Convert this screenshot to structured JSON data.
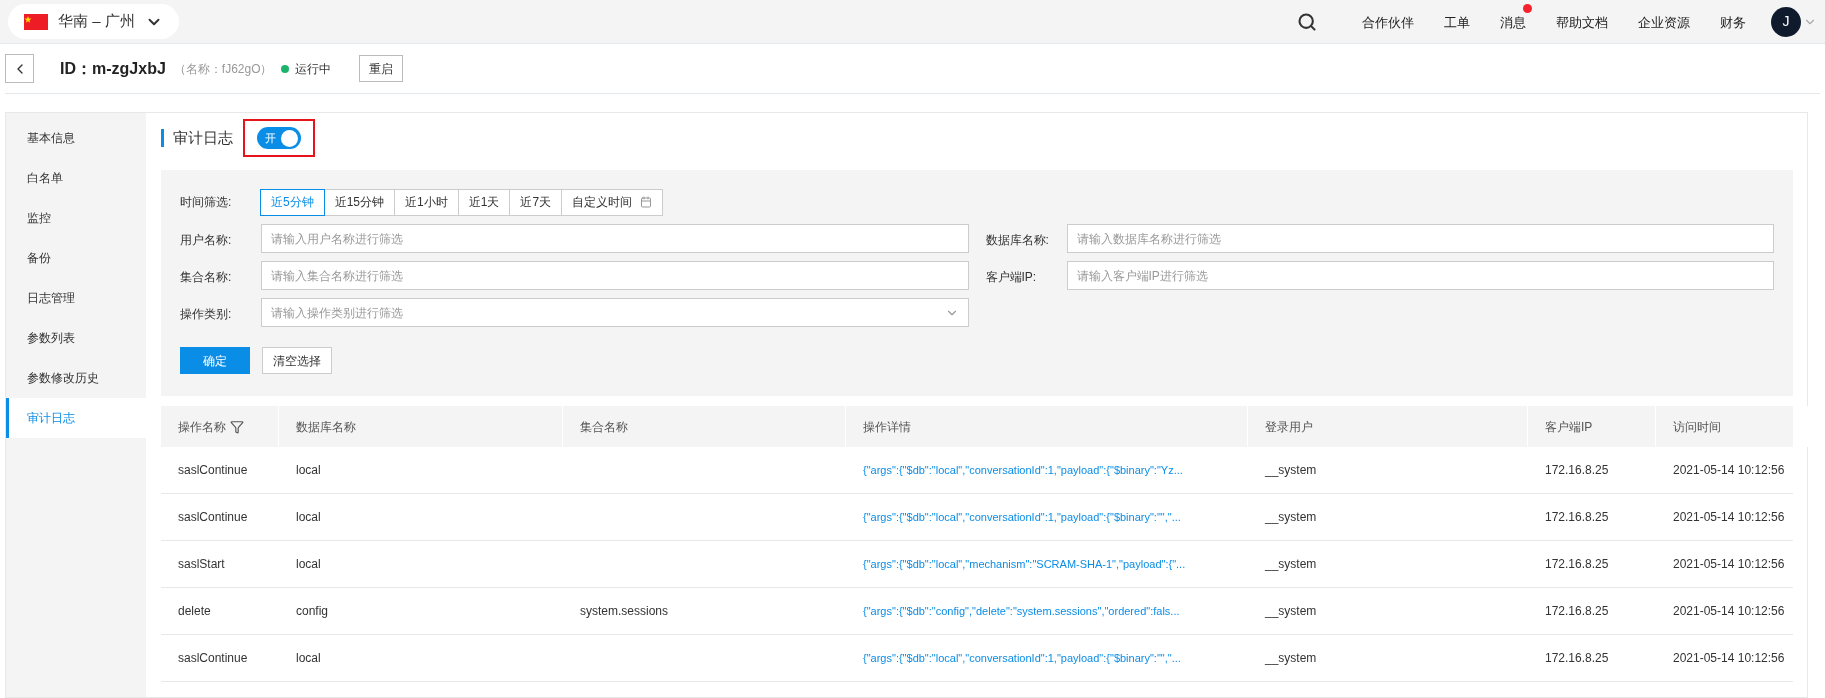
{
  "topbar": {
    "region": "华南 – 广州",
    "nav": [
      {
        "label": "合作伙伴",
        "badge": false
      },
      {
        "label": "工单",
        "badge": false
      },
      {
        "label": "消息",
        "badge": true
      },
      {
        "label": "帮助文档",
        "badge": false
      },
      {
        "label": "企业资源",
        "badge": false
      },
      {
        "label": "财务",
        "badge": false
      }
    ],
    "avatar": "J"
  },
  "header": {
    "id": "ID：m-zgJxbJ",
    "name": "（名称：fJ62gO）",
    "status": {
      "label": "运行中",
      "color": "#1db36b"
    },
    "restart": "重启"
  },
  "sidebar": {
    "items": [
      {
        "label": "基本信息",
        "selected": false
      },
      {
        "label": "白名单",
        "selected": false
      },
      {
        "label": "监控",
        "selected": false
      },
      {
        "label": "备份",
        "selected": false
      },
      {
        "label": "日志管理",
        "selected": false
      },
      {
        "label": "参数列表",
        "selected": false
      },
      {
        "label": "参数修改历史",
        "selected": false
      },
      {
        "label": "审计日志",
        "selected": true
      }
    ]
  },
  "section": {
    "title": "审计日志",
    "toggle": {
      "label": "开",
      "on": true
    }
  },
  "filters": {
    "time_label": "时间筛选:",
    "time_options": [
      {
        "label": "近5分钟",
        "selected": true
      },
      {
        "label": "近15分钟",
        "selected": false
      },
      {
        "label": "近1小时",
        "selected": false
      },
      {
        "label": "近1天",
        "selected": false
      },
      {
        "label": "近7天",
        "selected": false
      },
      {
        "label": "自定义时间",
        "selected": false
      }
    ],
    "fields": [
      {
        "label": "用户名称:",
        "placeholder": "请输入用户名称进行筛选"
      },
      {
        "label": "数据库名称:",
        "placeholder": "请输入数据库名称进行筛选"
      },
      {
        "label": "集合名称:",
        "placeholder": "请输入集合名称进行筛选"
      },
      {
        "label": "客户端IP:",
        "placeholder": "请输入客户端IP进行筛选"
      }
    ],
    "operation": {
      "label": "操作类别:",
      "placeholder": "请输入操作类别进行筛选"
    },
    "confirm": "确定",
    "clear": "清空选择"
  },
  "table": {
    "columns": [
      "操作名称",
      "数据库名称",
      "集合名称",
      "操作详情",
      "登录用户",
      "客户端IP",
      "访问时间"
    ],
    "rows": [
      [
        "saslContinue",
        "local",
        "",
        "{\"args\":{\"$db\":\"local\",\"conversationId\":1,\"payload\":{\"$binary\":\"Yz...",
        "__system",
        "172.16.8.25",
        "2021-05-14 10:12:56"
      ],
      [
        "saslContinue",
        "local",
        "",
        "{\"args\":{\"$db\":\"local\",\"conversationId\":1,\"payload\":{\"$binary\":\"\",\"...",
        "__system",
        "172.16.8.25",
        "2021-05-14 10:12:56"
      ],
      [
        "saslStart",
        "local",
        "",
        "{\"args\":{\"$db\":\"local\",\"mechanism\":\"SCRAM-SHA-1\",\"payload\":{\"...",
        "__system",
        "172.16.8.25",
        "2021-05-14 10:12:56"
      ],
      [
        "delete",
        "config",
        "system.sessions",
        "{\"args\":{\"$db\":\"config\",\"delete\":\"system.sessions\",\"ordered\":fals...",
        "__system",
        "172.16.8.25",
        "2021-05-14 10:12:56"
      ],
      [
        "saslContinue",
        "local",
        "",
        "{\"args\":{\"$db\":\"local\",\"conversationId\":1,\"payload\":{\"$binary\":\"\",\"...",
        "__system",
        "172.16.8.25",
        "2021-05-14 10:12:56"
      ]
    ]
  }
}
